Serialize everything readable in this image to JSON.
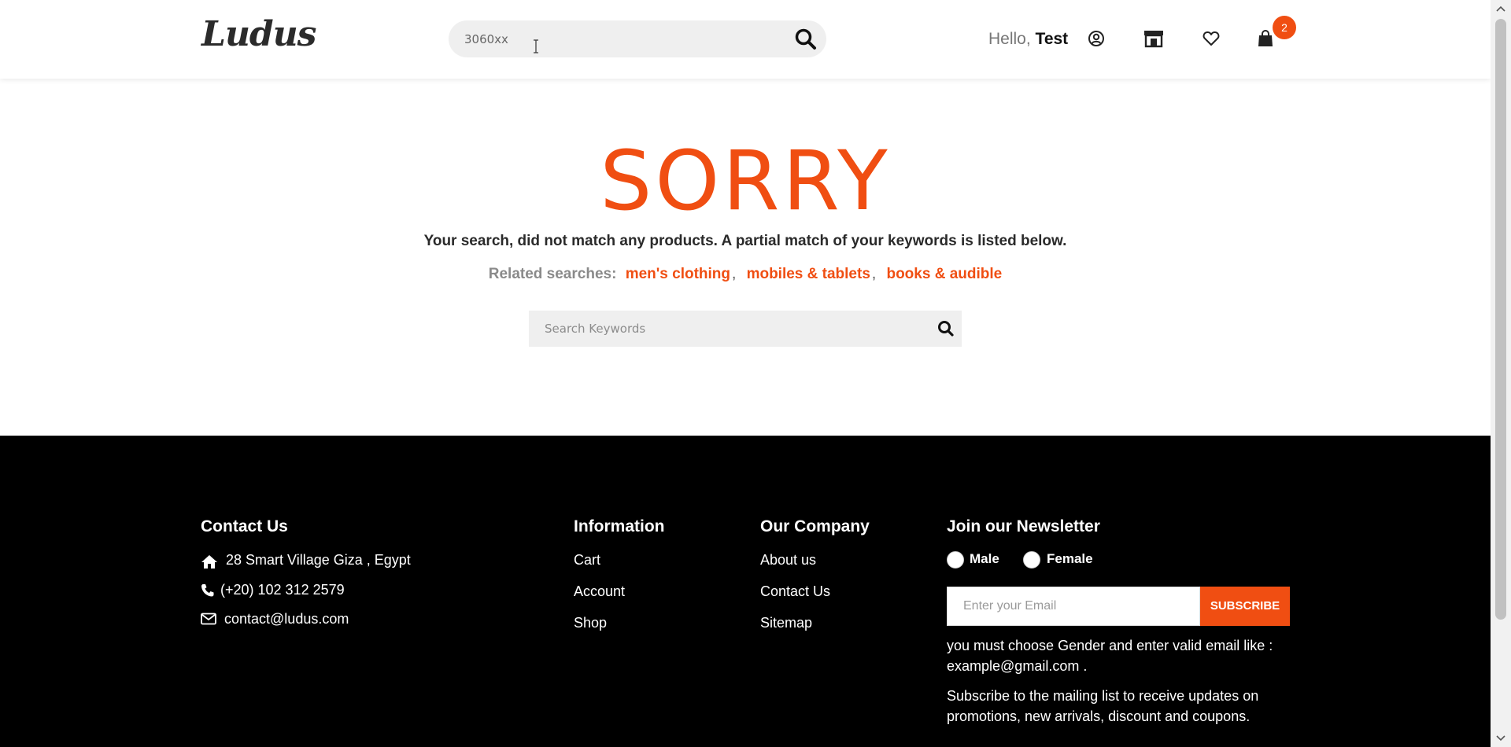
{
  "header": {
    "logo_text": "Ludus",
    "search": {
      "value": "3060xx"
    },
    "greeting_prefix": "Hello,",
    "user_name": "Test",
    "cart_count": "2",
    "icons": [
      "user-circle-icon",
      "store-icon",
      "heart-icon",
      "shopping-bag-icon",
      "search-icon"
    ]
  },
  "main": {
    "sorry_title": "SORRY",
    "message": "Your search, did not match any products. A partial match of your keywords is listed below.",
    "related_label": "Related searches:",
    "related": [
      "men's clothing",
      "mobiles & tablets",
      "books & audible"
    ],
    "separator": ",",
    "keyword_search": {
      "placeholder": "Search Keywords"
    }
  },
  "footer": {
    "contact": {
      "title": "Contact Us",
      "address": "28 Smart Village Giza , Egypt",
      "phone": "(+20) 102 312 2579",
      "email": "contact@ludus.com"
    },
    "information": {
      "title": "Information",
      "links": [
        "Cart",
        "Account",
        "Shop"
      ]
    },
    "company": {
      "title": "Our Company",
      "links": [
        "About us",
        "Contact Us",
        "Sitemap"
      ]
    },
    "newsletter": {
      "title": "Join our Newsletter",
      "gender_options": [
        "Male",
        "Female"
      ],
      "email_placeholder": "Enter your Email",
      "subscribe_label": "SUBSCRIBE",
      "validation_note": "you must choose Gender and enter valid email like : example@gmail.com .",
      "description": "Subscribe to the mailing list to receive updates on promotions, new arrivals, discount and coupons."
    }
  },
  "colors": {
    "accent": "#f04e12",
    "footer_bg": "#000000",
    "search_bg": "#efefef"
  }
}
